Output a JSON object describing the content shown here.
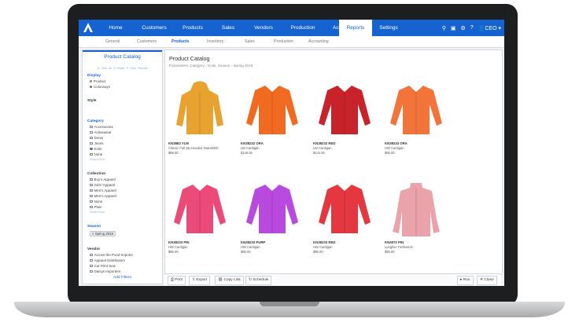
{
  "nav": {
    "tabs": [
      {
        "label": "Home"
      },
      {
        "label": "Customers"
      },
      {
        "label": "Products"
      },
      {
        "label": "Sales"
      },
      {
        "label": "Vendors"
      },
      {
        "label": "Production"
      },
      {
        "label": "Accounting"
      },
      {
        "label": "Reports"
      },
      {
        "label": "Settings"
      }
    ],
    "active_tab": "Reports",
    "user_label": "CEO",
    "accent": "#1463d1"
  },
  "subnav": {
    "items": [
      {
        "label": "General"
      },
      {
        "label": "Customers"
      },
      {
        "label": "Products"
      },
      {
        "label": "Inventory"
      },
      {
        "label": "Sales"
      },
      {
        "label": "Production"
      },
      {
        "label": "Accounting"
      }
    ],
    "active": "Products"
  },
  "sidebar": {
    "title": "Product Catalog",
    "links": "⊟ View All   ⟲ Reset   ✦ Save Results",
    "display": {
      "heading": "Display",
      "options": [
        "Product",
        "Colorways"
      ],
      "selected": "Colorways"
    },
    "style_heading": "Style",
    "category": {
      "heading": "Category",
      "options": [
        "Accessories",
        "Activewear",
        "Dress",
        "Jeans",
        "Knits",
        "None"
      ],
      "checked": "Knits",
      "more": "Show More"
    },
    "collection": {
      "heading": "Collection",
      "options": [
        "Boy's Apparel",
        "Girls' Apparel",
        "Men's Apparel",
        "Men's Apparel",
        "None",
        "Plain"
      ],
      "more": "Show More"
    },
    "season": {
      "heading": "Season",
      "tag": "× Spring 2019"
    },
    "vendor": {
      "heading": "Vendor",
      "options": [
        "Across the Pond Imports",
        "Apparel Distributors",
        "Cut Print Sew",
        "Daisys Importers"
      ]
    },
    "add_filters": "Add Filters"
  },
  "main": {
    "title": "Product Catalog",
    "params": "Parameters: Category - Knits, Season - Spring 2019",
    "products": [
      {
        "sku": "KN3883 YLW",
        "name": "Classic Full Zip Hooded Sweatshirt",
        "price": "$58.00",
        "color": "#e8a230",
        "kind": "hoodie"
      },
      {
        "sku": "KN38232 ORA",
        "name": "LW Cardigan",
        "price": "$140.00",
        "color": "#f06a21",
        "kind": "cardigan"
      },
      {
        "sku": "KN38232 RED",
        "name": "LW Cardigan",
        "price": "$144.00",
        "color": "#c8232b",
        "kind": "cardigan"
      },
      {
        "sku": "KN38233 ORA",
        "name": "HW Cardigan",
        "price": "$95.00",
        "color": "#f2743a",
        "kind": "cardigan"
      },
      {
        "sku": "KN38233 PIN",
        "name": "HW Cardigan",
        "price": "$95.00",
        "color": "#ec4a78",
        "kind": "cardigan"
      },
      {
        "sku": "KN38233 PURP",
        "name": "HW Cardigan",
        "price": "$95.00",
        "color": "#b94ae0",
        "kind": "cardigan"
      },
      {
        "sku": "KN38233 RED",
        "name": "HW Cardigan",
        "price": "$95.00",
        "color": "#e4373f",
        "kind": "cardigan"
      },
      {
        "sku": "KN4972 PIN",
        "name": "Longline Turtleneck",
        "price": "$95.00",
        "color": "#eaa3ab",
        "kind": "turtleneck"
      }
    ]
  },
  "footer": {
    "print": "Print",
    "export": "Export",
    "copy_link": "Copy Link",
    "schedule": "Schedule",
    "run": "Run",
    "close": "Close"
  }
}
